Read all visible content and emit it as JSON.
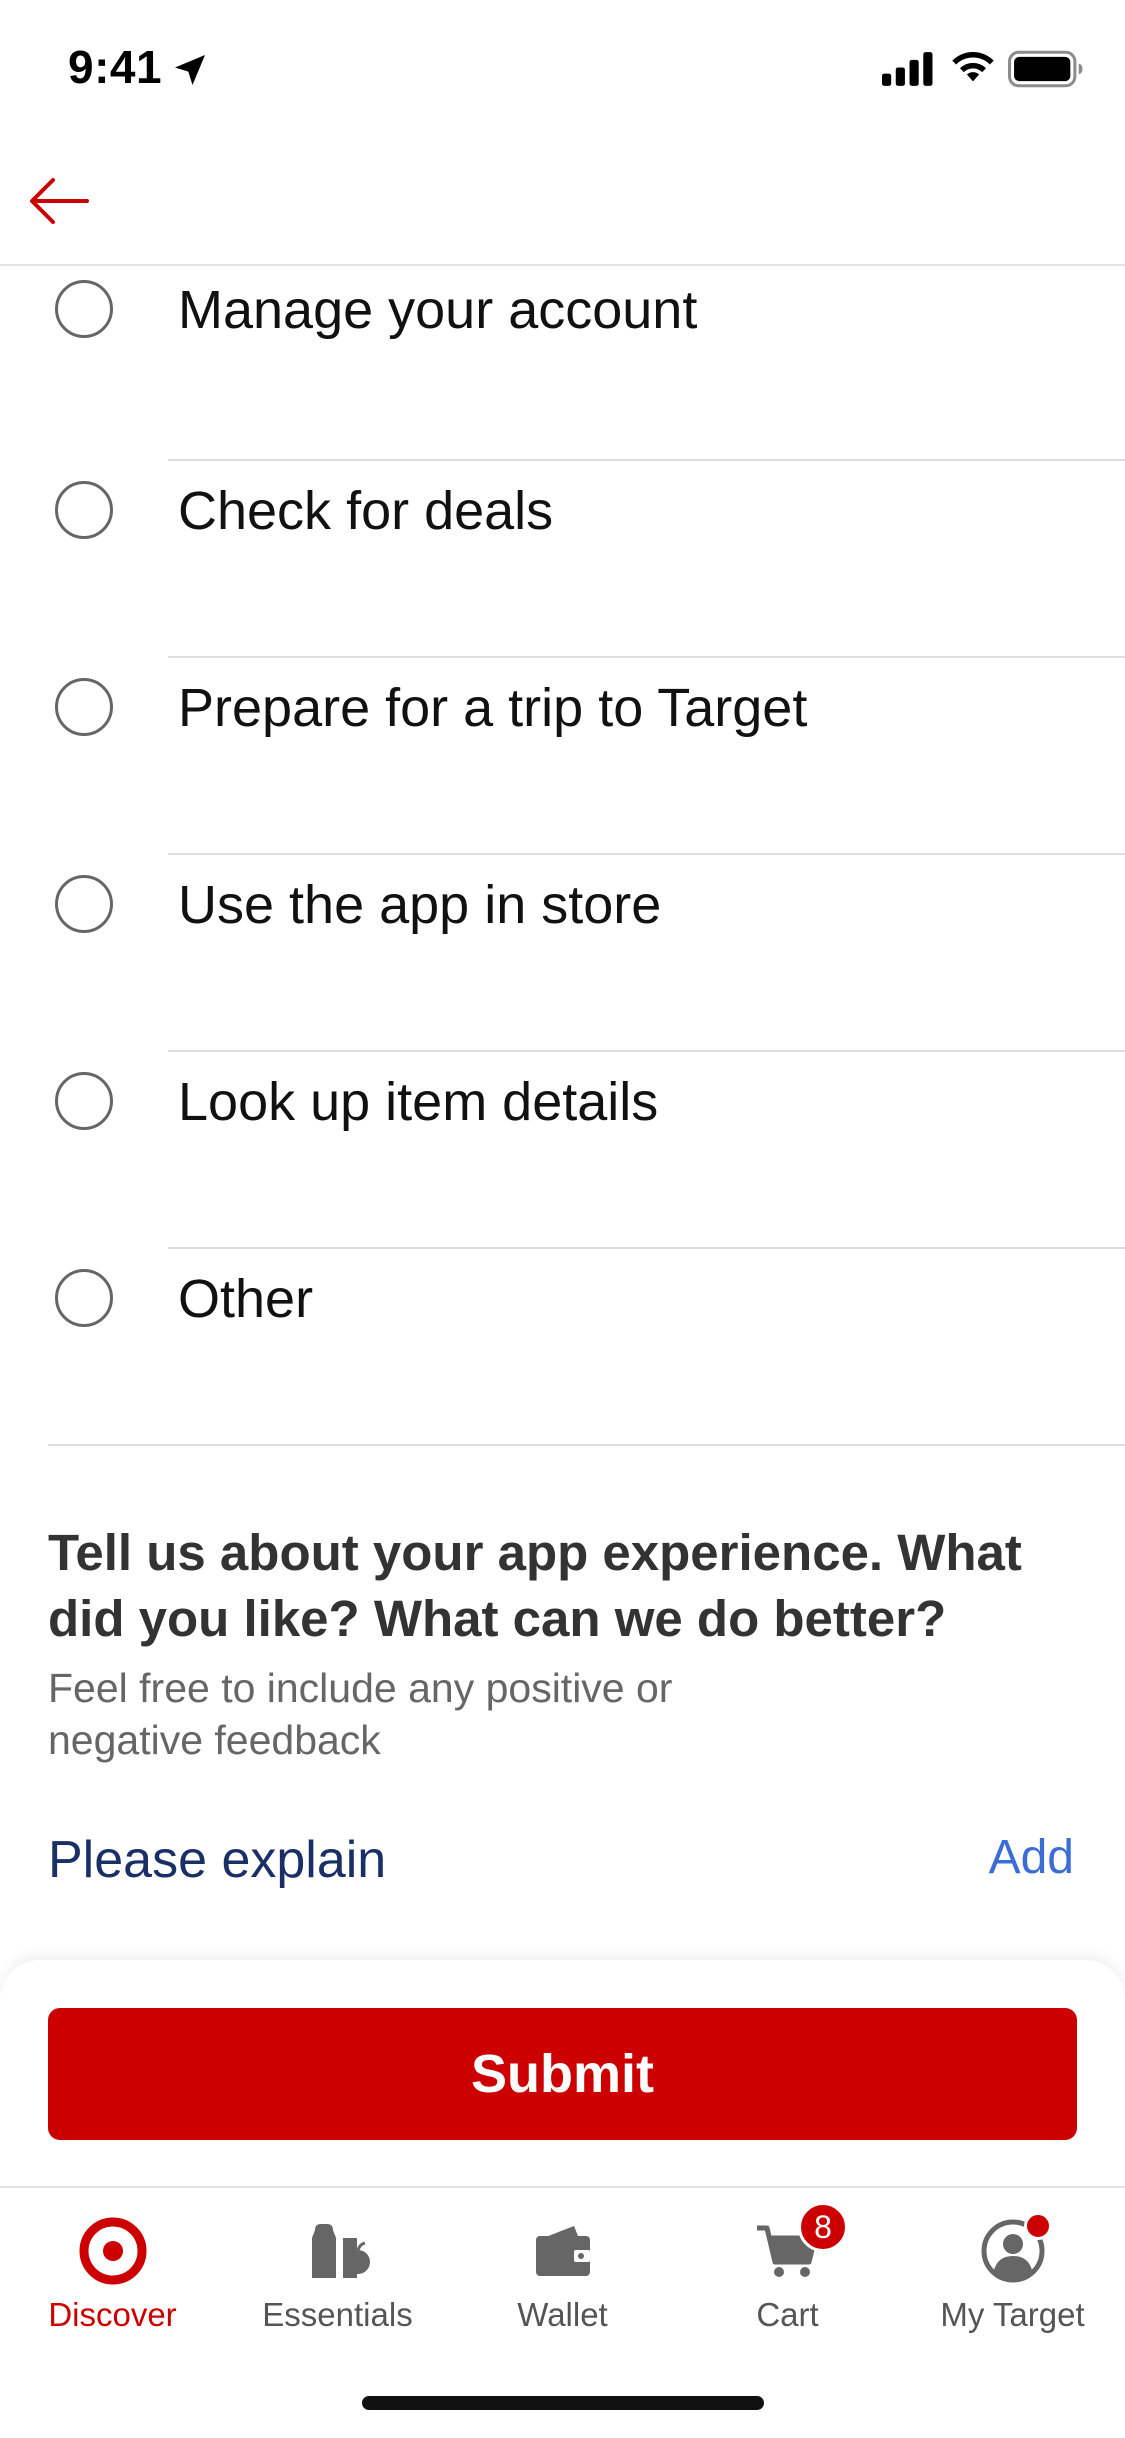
{
  "status_bar": {
    "time": "9:41"
  },
  "header": {
    "back_icon": "arrow-left-icon"
  },
  "options": [
    {
      "label": "Manage your account",
      "selected": false
    },
    {
      "label": "Check for deals",
      "selected": false
    },
    {
      "label": "Prepare for a trip to Target",
      "selected": false
    },
    {
      "label": "Use the app in store",
      "selected": false
    },
    {
      "label": "Look up item details",
      "selected": false
    },
    {
      "label": "Other",
      "selected": false
    }
  ],
  "feedback": {
    "title": "Tell us about your app experience. What did you like? What can we do better?",
    "subtitle": "Feel free to include any positive or negative feedback",
    "explain_label": "Please explain",
    "add_label": "Add"
  },
  "submit": {
    "label": "Submit"
  },
  "tabbar": {
    "tabs": [
      {
        "label": "Discover",
        "icon": "target-logo-icon",
        "active": true
      },
      {
        "label": "Essentials",
        "icon": "essentials-icon",
        "active": false
      },
      {
        "label": "Wallet",
        "icon": "wallet-icon",
        "active": false
      },
      {
        "label": "Cart",
        "icon": "cart-icon",
        "active": false
      },
      {
        "label": "My Target",
        "icon": "profile-icon",
        "active": false
      }
    ],
    "cart_count": "8"
  },
  "colors": {
    "brand_red": "#cc0000",
    "link_blue": "#3a6ed6",
    "explain_navy": "#1a2f66"
  }
}
